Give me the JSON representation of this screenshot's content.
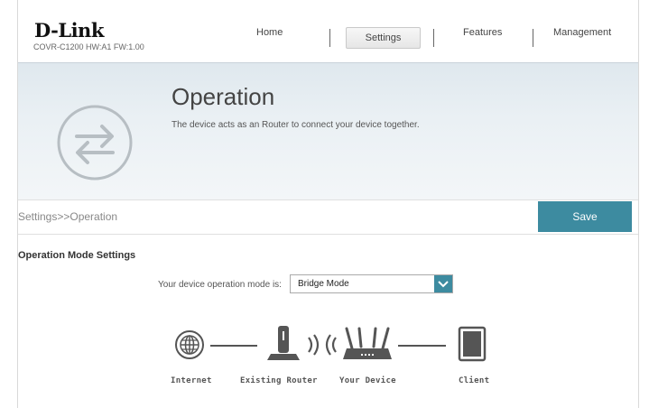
{
  "brand": {
    "logo": "D-Link",
    "model_info": "COVR-C1200 HW:A1 FW:1.00"
  },
  "nav": {
    "items": [
      {
        "label": "Home"
      },
      {
        "label": "Settings"
      },
      {
        "label": "Features"
      },
      {
        "label": "Management"
      }
    ],
    "active": "Settings"
  },
  "banner": {
    "title": "Operation",
    "description": "The device acts as an Router to connect your device together.",
    "icon": "swap-arrows-icon"
  },
  "breadcrumb": "Settings>>Operation",
  "toolbar": {
    "save_label": "Save"
  },
  "operation_mode": {
    "section_title": "Operation Mode Settings",
    "label": "Your device operation mode is:",
    "selected_value": "Bridge Mode"
  },
  "topology": {
    "nodes": [
      {
        "label": "Internet",
        "icon": "globe-icon"
      },
      {
        "label": "Existing Router",
        "icon": "router-antenna-icon"
      },
      {
        "label": "Your Device",
        "icon": "wifi-router-icon"
      },
      {
        "label": "Client",
        "icon": "tablet-icon"
      }
    ],
    "wireless_icon": "wireless-waves-icon"
  },
  "colors": {
    "accent": "#3d8ba0",
    "banner_bg": "#e6edf2",
    "text_dark": "#333333"
  }
}
